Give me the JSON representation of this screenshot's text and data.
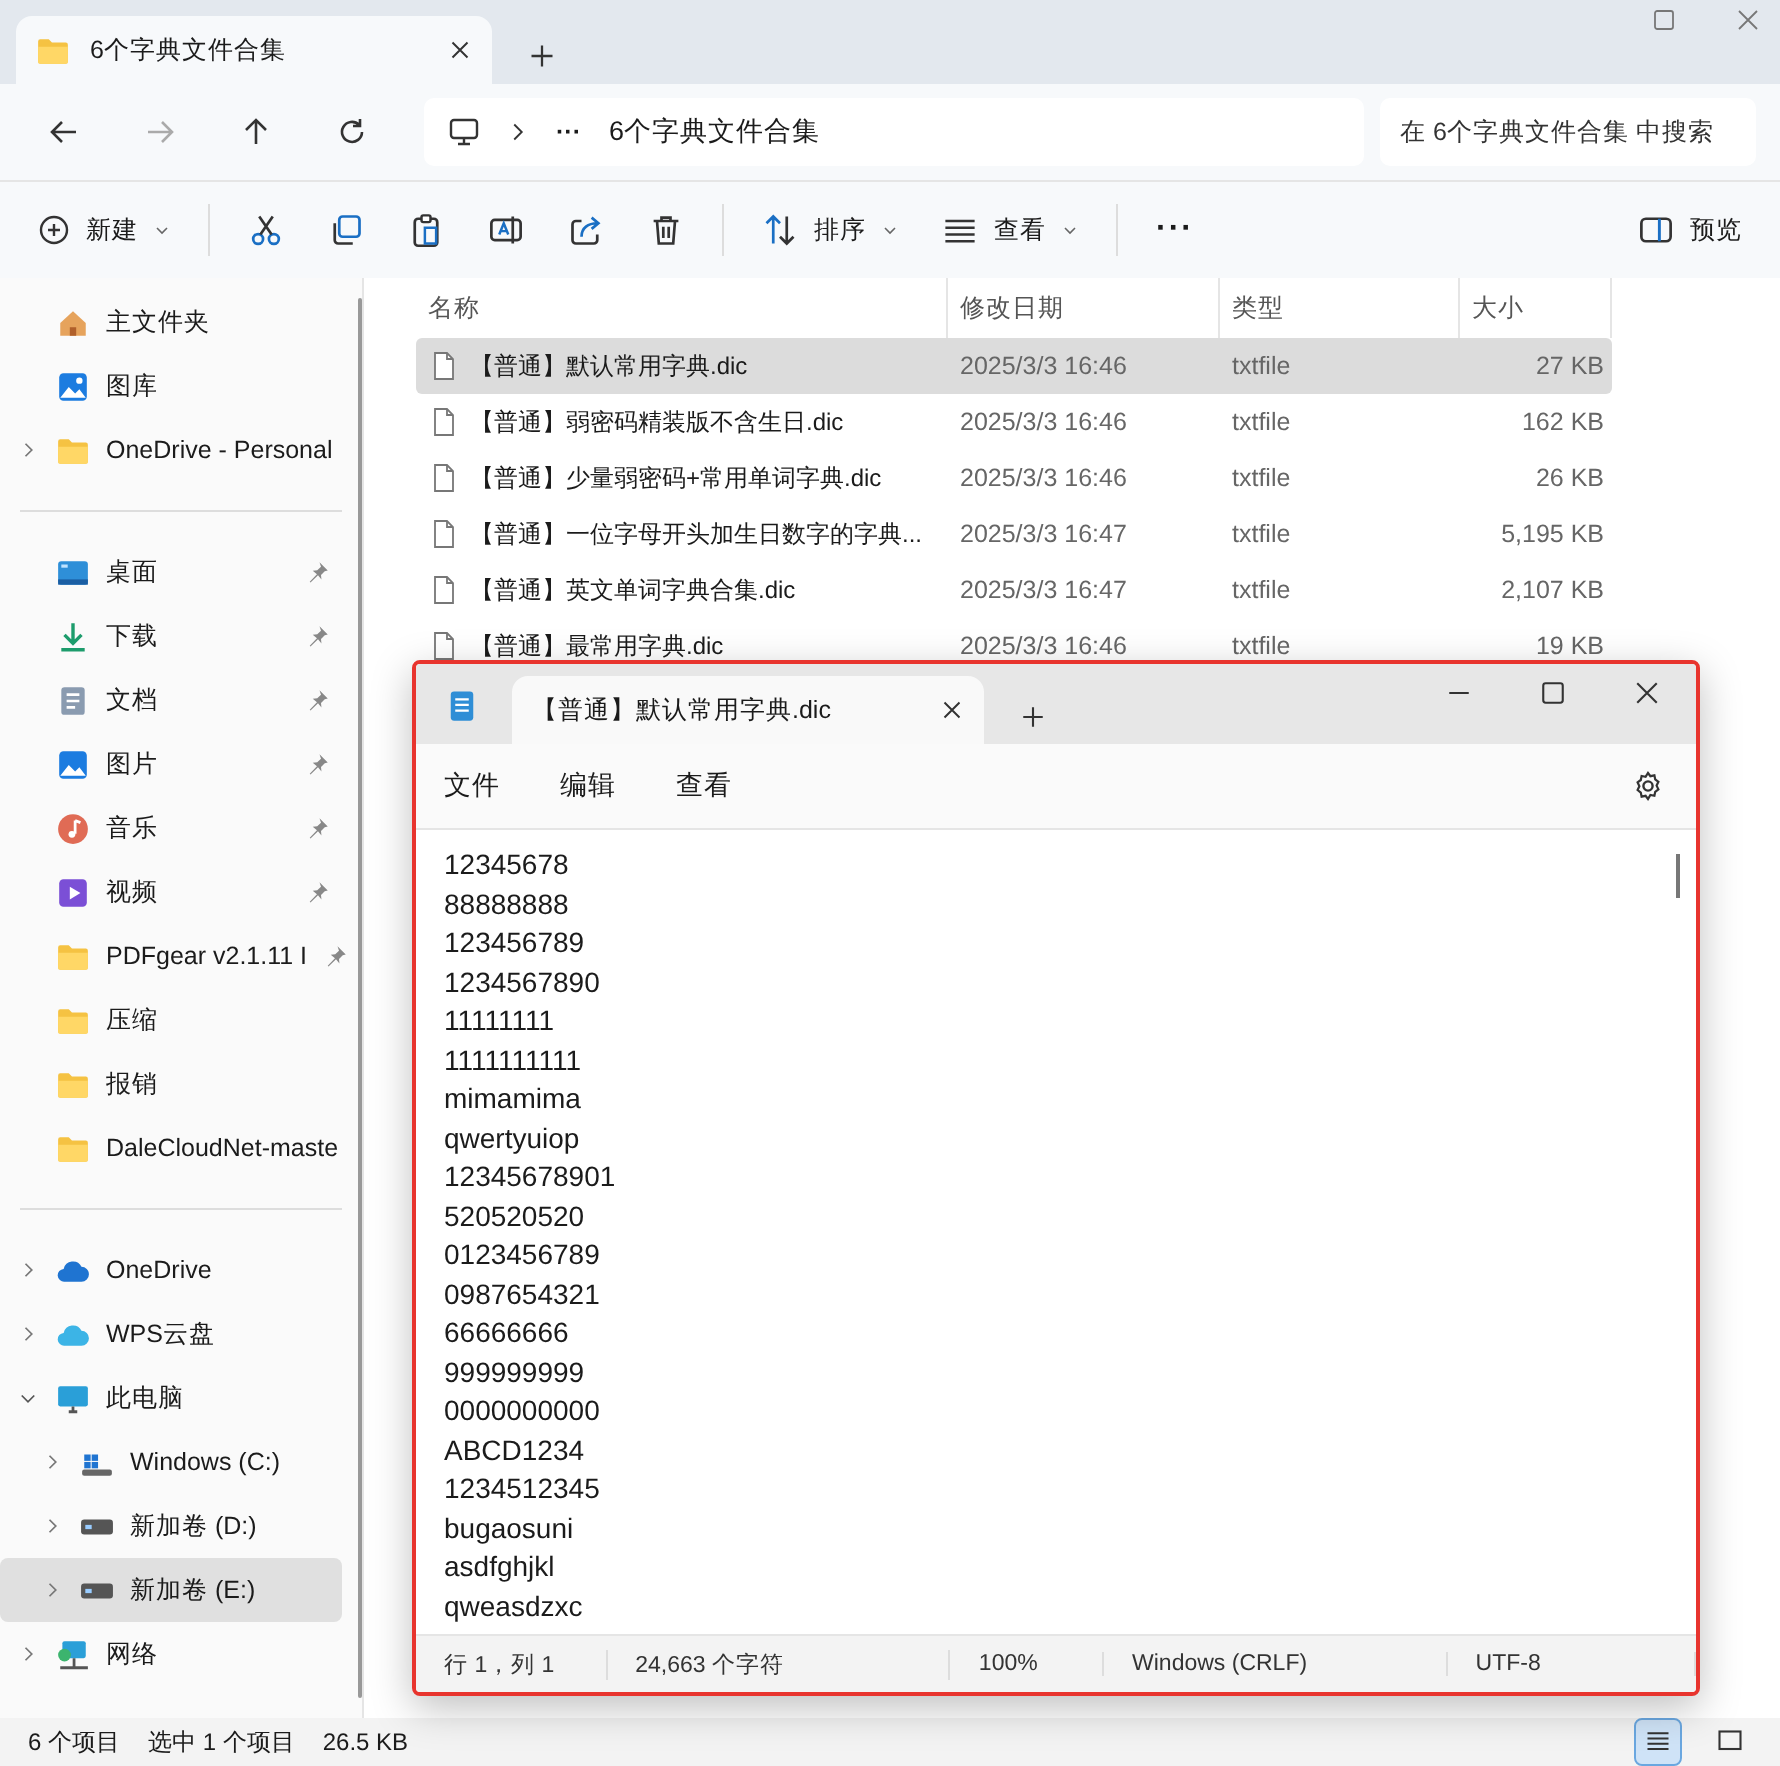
{
  "explorer": {
    "tab_title": "6个字典文件合集",
    "nav": [
      {
        "kind": "back",
        "disabled": false
      },
      {
        "kind": "forward",
        "disabled": true
      },
      {
        "kind": "up",
        "disabled": false
      },
      {
        "kind": "refresh",
        "disabled": false
      }
    ],
    "address": {
      "ellipsis": "···",
      "path": "6个字典文件合集"
    },
    "search": {
      "placeholder": "在 6个字典文件合集 中搜索"
    },
    "toolbar": [
      {
        "kind": "new",
        "label": "新建"
      },
      {
        "kind": "cut"
      },
      {
        "kind": "copy"
      },
      {
        "kind": "paste"
      },
      {
        "kind": "rename"
      },
      {
        "kind": "share"
      },
      {
        "kind": "delete"
      },
      {
        "kind": "sort",
        "label": "排序"
      },
      {
        "kind": "view",
        "label": "查看"
      },
      {
        "kind": "more",
        "label": "···"
      },
      {
        "kind": "preview",
        "label": "预览"
      }
    ],
    "sidebar": [
      [
        {
          "kind": "home",
          "label": "主文件夹",
          "selected": false
        },
        {
          "kind": "gallery",
          "label": "图库",
          "selected": false
        },
        {
          "kind": "folder",
          "label": "OneDrive - Personal",
          "expandable": true,
          "expanded": false,
          "selected": false
        }
      ],
      [
        {
          "kind": "desktop",
          "label": "桌面",
          "pinned": true,
          "selected": false
        },
        {
          "kind": "download",
          "label": "下载",
          "pinned": true,
          "selected": false
        },
        {
          "kind": "docs",
          "label": "文档",
          "pinned": true,
          "selected": false
        },
        {
          "kind": "pictures",
          "label": "图片",
          "pinned": true,
          "selected": false
        },
        {
          "kind": "music",
          "label": "音乐",
          "pinned": true,
          "selected": false
        },
        {
          "kind": "video",
          "label": "视频",
          "pinned": true,
          "selected": false
        },
        {
          "kind": "folder",
          "label": "PDFgear v2.1.11 I",
          "pinned": true,
          "selected": false
        },
        {
          "kind": "folder",
          "label": "压缩",
          "pinned": false,
          "selected": false
        },
        {
          "kind": "folder",
          "label": "报销",
          "pinned": false,
          "selected": false
        },
        {
          "kind": "folder",
          "label": "DaleCloudNet-maste",
          "pinned": false,
          "selected": false
        }
      ],
      [
        {
          "kind": "cloud",
          "label": "OneDrive",
          "expandable": true,
          "expanded": false,
          "selected": false
        },
        {
          "kind": "wps",
          "label": "WPS云盘",
          "expandable": true,
          "expanded": false,
          "selected": false
        },
        {
          "kind": "pc",
          "label": "此电脑",
          "expandable": true,
          "expanded": true,
          "selected": false,
          "children": [
            {
              "kind": "windrive",
              "label": "Windows (C:)",
              "expandable": true,
              "expanded": false,
              "selected": false
            },
            {
              "kind": "drive",
              "label": "新加卷 (D:)",
              "expandable": true,
              "expanded": false,
              "selected": false
            },
            {
              "kind": "drive",
              "label": "新加卷 (E:)",
              "expandable": true,
              "expanded": false,
              "selected": true
            }
          ]
        },
        {
          "kind": "network",
          "label": "网络",
          "expandable": true,
          "expanded": false,
          "selected": false
        }
      ]
    ],
    "columns": [
      "名称",
      "修改日期",
      "类型",
      "大小"
    ],
    "rows": [
      {
        "name": "【普通】默认常用字典.dic",
        "date": "2025/3/3 16:46",
        "type": "txtfile",
        "size": "27 KB",
        "selected": true
      },
      {
        "name": "【普通】弱密码精装版不含生日.dic",
        "date": "2025/3/3 16:46",
        "type": "txtfile",
        "size": "162 KB",
        "selected": false
      },
      {
        "name": "【普通】少量弱密码+常用单词字典.dic",
        "date": "2025/3/3 16:46",
        "type": "txtfile",
        "size": "26 KB",
        "selected": false
      },
      {
        "name": "【普通】一位字母开头加生日数字的字典...",
        "date": "2025/3/3 16:47",
        "type": "txtfile",
        "size": "5,195 KB",
        "selected": false
      },
      {
        "name": "【普通】英文单词字典合集.dic",
        "date": "2025/3/3 16:47",
        "type": "txtfile",
        "size": "2,107 KB",
        "selected": false
      },
      {
        "name": "【普通】最常用字典.dic",
        "date": "2025/3/3 16:46",
        "type": "txtfile",
        "size": "19 KB",
        "selected": false
      }
    ],
    "status": {
      "count": "6 个项目",
      "selection": "选中 1 个项目",
      "size": "26.5 KB"
    },
    "view_modes": [
      {
        "kind": "details",
        "selected": true
      },
      {
        "kind": "tiles",
        "selected": false
      }
    ]
  },
  "notepad": {
    "tab_title": "【普通】默认常用字典.dic",
    "menu": [
      "文件",
      "编辑",
      "查看"
    ],
    "lines": [
      "12345678",
      "88888888",
      "123456789",
      "1234567890",
      "11111111",
      "1111111111",
      "mimamima",
      "qwertyuiop",
      "12345678901",
      "520520520",
      "0123456789",
      "0987654321",
      "66666666",
      "999999999",
      "0000000000",
      "ABCD1234",
      "1234512345",
      "bugaosuni",
      "asdfghjkl",
      "qweasdzxc"
    ],
    "status": [
      "行 1，列 1",
      "24,663 个字符",
      "100%",
      "Windows (CRLF)",
      "UTF-8"
    ]
  }
}
